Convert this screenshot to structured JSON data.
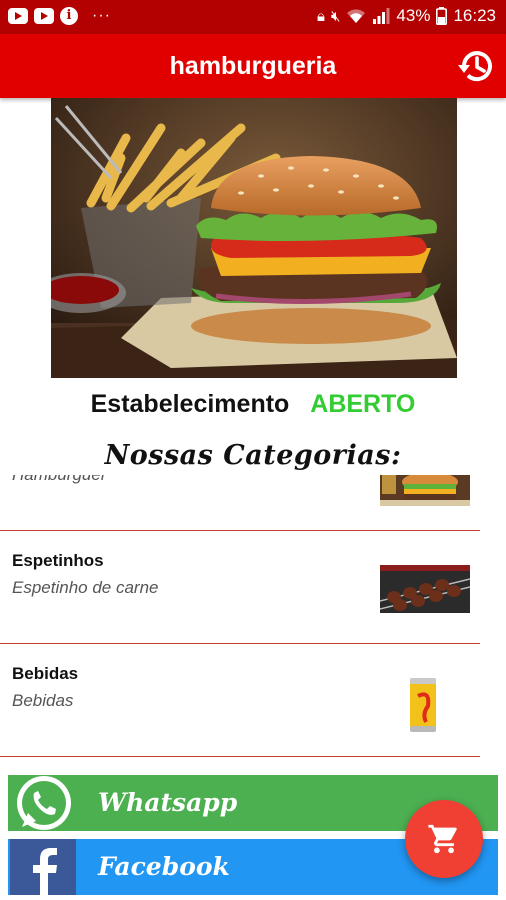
{
  "status_bar": {
    "notification_icons": [
      "youtube-icon",
      "youtube-icon",
      "info-icon"
    ],
    "more_dots": "···",
    "battery": "43%",
    "time": "16:23"
  },
  "app_bar": {
    "title": "hamburgueria",
    "history_icon": "history-icon"
  },
  "hero": {
    "image_subject": "burger-with-fries"
  },
  "establishment": {
    "label": "Estabelecimento",
    "status": "ABERTO",
    "status_color": "#33cc33"
  },
  "categories": {
    "title": "Nossas Categorias:",
    "items": [
      {
        "title": "",
        "subtitle": "Hamburguer",
        "thumb": "burger-thumb"
      },
      {
        "title": "Espetinhos",
        "subtitle": "Espetinho de  carne",
        "thumb": "skewer-thumb"
      },
      {
        "title": "Bebidas",
        "subtitle": "Bebidas",
        "thumb": "can-thumb"
      }
    ]
  },
  "social": {
    "whatsapp_label": "Whatsapp",
    "whatsapp_color": "#4caf50",
    "facebook_label": "Facebook",
    "facebook_color": "#2196f3"
  },
  "fab": {
    "icon": "cart-icon",
    "color": "#f04034"
  },
  "colors": {
    "status_bar": "#b30000",
    "app_bar": "#e00000"
  }
}
